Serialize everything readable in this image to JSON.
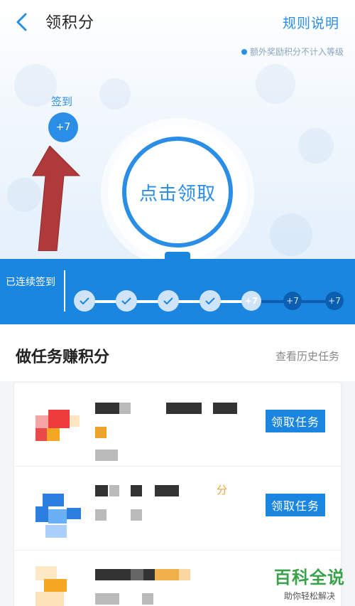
{
  "header": {
    "title": "领积分",
    "rules_label": "规则说明"
  },
  "note": "额外奖励积分不计入等级",
  "signin": {
    "label": "签到",
    "bonus": "+7"
  },
  "claim": {
    "label": "点击领取"
  },
  "streak": {
    "label": "已连续签到",
    "days": [
      {
        "state": "done",
        "text": ""
      },
      {
        "state": "done",
        "text": ""
      },
      {
        "state": "done",
        "text": ""
      },
      {
        "state": "done",
        "text": ""
      },
      {
        "state": "now",
        "text": "+7"
      },
      {
        "state": "future",
        "text": "+7"
      },
      {
        "state": "future",
        "text": "+7"
      }
    ]
  },
  "tasks": {
    "title": "做任务赚积分",
    "history_label": "查看历史任务",
    "items": [
      {
        "button": "领取任务",
        "points": ""
      },
      {
        "button": "领取任务",
        "points": "分"
      },
      {
        "button": "",
        "points": ""
      }
    ]
  },
  "watermark": {
    "main": "百科全说",
    "sub": "助你轻松解决"
  },
  "colors": {
    "accent": "#2a8ee6",
    "streak_bg": "#1b86e0",
    "arrow": "#b03a3a",
    "watermark": "#3aa24a"
  },
  "icons": {
    "back": "chevron-left-icon",
    "check": "check-icon"
  }
}
